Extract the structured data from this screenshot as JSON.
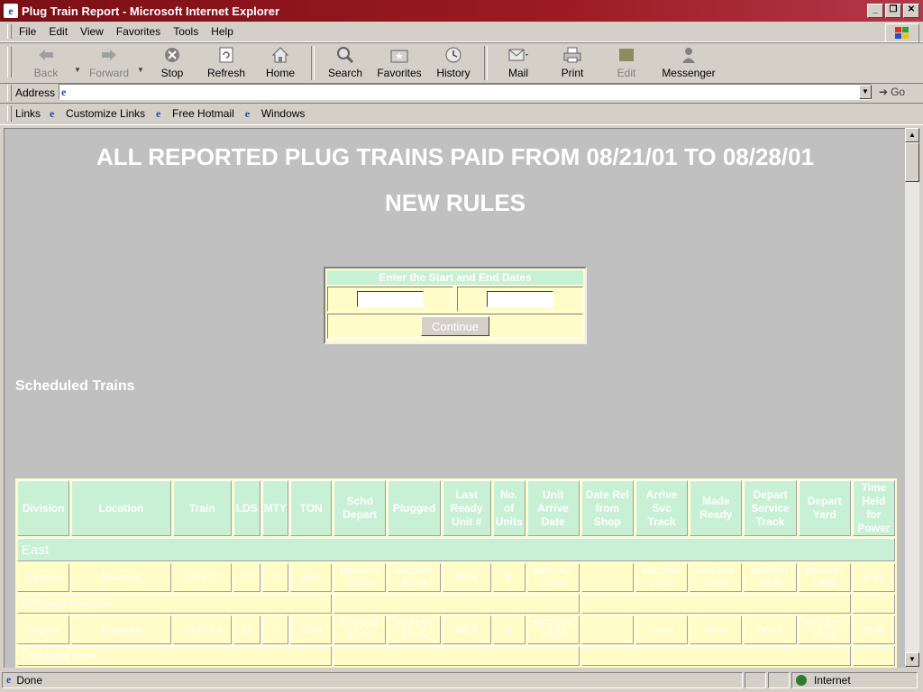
{
  "window": {
    "title": "Plug Train Report - Microsoft Internet Explorer"
  },
  "menu": [
    "File",
    "Edit",
    "View",
    "Favorites",
    "Tools",
    "Help"
  ],
  "toolbar": {
    "back": "Back",
    "forward": "Forward",
    "stop": "Stop",
    "refresh": "Refresh",
    "home": "Home",
    "search": "Search",
    "favorites": "Favorites",
    "history": "History",
    "mail": "Mail",
    "print": "Print",
    "edit": "Edit",
    "messenger": "Messenger"
  },
  "address": {
    "label": "Address",
    "value": "",
    "go": "Go"
  },
  "links": {
    "label": "Links",
    "items": [
      "Customize Links",
      "Free Hotmail",
      "Windows"
    ]
  },
  "page": {
    "title": "ALL REPORTED PLUG TRAINS PAID FROM 08/21/01 TO 08/28/01",
    "subtitle": "NEW RULES",
    "form": {
      "header": "Enter the Start and End Dates",
      "start_value": "",
      "end_value": "",
      "button": "Continue"
    },
    "section": "Scheduled Trains",
    "table": {
      "columns": [
        "Division",
        "Location",
        "Train",
        "LDS",
        "MTY",
        "TON",
        "Schd Depart",
        "Plugged",
        "Last Ready Unit #",
        "No. of Units",
        "Unit Arrive Date",
        "Date Rel from Shop",
        "Arrive Svc Track",
        "Made Ready",
        "Depart Service Track",
        "Depart Yard",
        "Time Held for Power"
      ],
      "region": "East",
      "rows": [
        [
          "Virginia",
          "Roanoke",
          "V123 21",
          "13",
          "4",
          "4961",
          "08/22/01 18:00",
          "08/22/01 18:35",
          "8924",
          "3",
          "08/22/01 17:40",
          "",
          "08/22/01 17:50",
          "08/22/01 18:30",
          "08/22/01 18:35",
          "08/22/01 19:00",
          "0:35"
        ],
        [
          "Virginia",
          "Roanoke",
          "V125 23",
          "21",
          "0",
          "6145",
          "08/24/01 19:00",
          "08/24/01 19:45",
          "8910",
          "3",
          "08/24/01 18:30",
          "",
          "None",
          "None",
          "None",
          "08/24/01 19:45",
          "0:45"
        ]
      ],
      "notes": [
        "Relocated from yard",
        "Unplugged power"
      ]
    }
  },
  "status": {
    "left": "Done",
    "zone": "Internet"
  }
}
